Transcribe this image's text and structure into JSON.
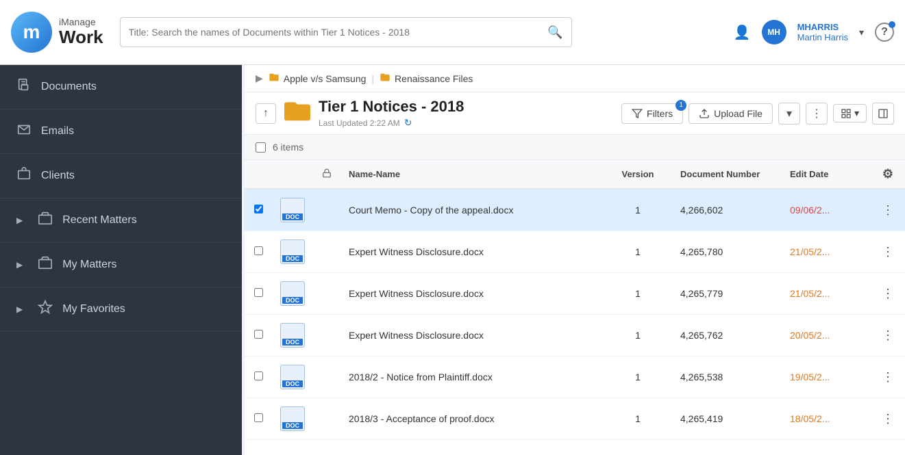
{
  "header": {
    "logo_letter": "m",
    "logo_brand": "iManage",
    "logo_product": "Work",
    "search_placeholder": "Title: Search the names of Documents within Tier 1 Notices - 2018",
    "user_initials": "MH",
    "user_id": "MHARRIS",
    "user_full_name": "Martin Harris",
    "help_label": "?"
  },
  "sidebar": {
    "items": [
      {
        "id": "documents",
        "label": "Documents",
        "icon": "📄",
        "expandable": false
      },
      {
        "id": "emails",
        "label": "Emails",
        "icon": "✉",
        "expandable": false
      },
      {
        "id": "clients",
        "label": "Clients",
        "icon": "💼",
        "expandable": false
      },
      {
        "id": "recent-matters",
        "label": "Recent Matters",
        "icon": "🗂",
        "expandable": true
      },
      {
        "id": "my-matters",
        "label": "My Matters",
        "icon": "🗂",
        "expandable": true
      },
      {
        "id": "my-favorites",
        "label": "My Favorites",
        "icon": "☆",
        "expandable": true
      }
    ]
  },
  "breadcrumb": {
    "items": [
      {
        "label": "Apple v/s Samsung",
        "icon": "folder"
      },
      {
        "label": "Renaissance Files",
        "icon": "folder"
      }
    ]
  },
  "folder": {
    "title": "Tier 1 Notices - 2018",
    "last_updated": "Last Updated 2:22 AM",
    "items_count": "6 items",
    "filter_label": "Filters",
    "filter_count": "1",
    "upload_label": "Upload File"
  },
  "table": {
    "columns": [
      {
        "id": "check",
        "label": ""
      },
      {
        "id": "icon",
        "label": ""
      },
      {
        "id": "lock",
        "label": "🔒"
      },
      {
        "id": "name",
        "label": "Name-Name"
      },
      {
        "id": "version",
        "label": "Version"
      },
      {
        "id": "docnum",
        "label": "Document Number"
      },
      {
        "id": "editdate",
        "label": "Edit Date"
      },
      {
        "id": "actions",
        "label": "⚙"
      }
    ],
    "rows": [
      {
        "id": 1,
        "name": "Court Memo - Copy of the appeal.docx",
        "version": "1",
        "doc_number": "4,266,602",
        "edit_date": "09/06/2...",
        "selected": true
      },
      {
        "id": 2,
        "name": "Expert Witness Disclosure.docx",
        "version": "1",
        "doc_number": "4,265,780",
        "edit_date": "21/05/2...",
        "selected": false
      },
      {
        "id": 3,
        "name": "Expert Witness Disclosure.docx",
        "version": "1",
        "doc_number": "4,265,779",
        "edit_date": "21/05/2...",
        "selected": false
      },
      {
        "id": 4,
        "name": "Expert Witness Disclosure.docx",
        "version": "1",
        "doc_number": "4,265,762",
        "edit_date": "20/05/2...",
        "selected": false
      },
      {
        "id": 5,
        "name": "2018/2 - Notice from Plaintiff.docx",
        "version": "1",
        "doc_number": "4,265,538",
        "edit_date": "19/05/2...",
        "selected": false
      },
      {
        "id": 6,
        "name": "2018/3 - Acceptance of proof.docx",
        "version": "1",
        "doc_number": "4,265,419",
        "edit_date": "18/05/2...",
        "selected": false
      }
    ]
  }
}
